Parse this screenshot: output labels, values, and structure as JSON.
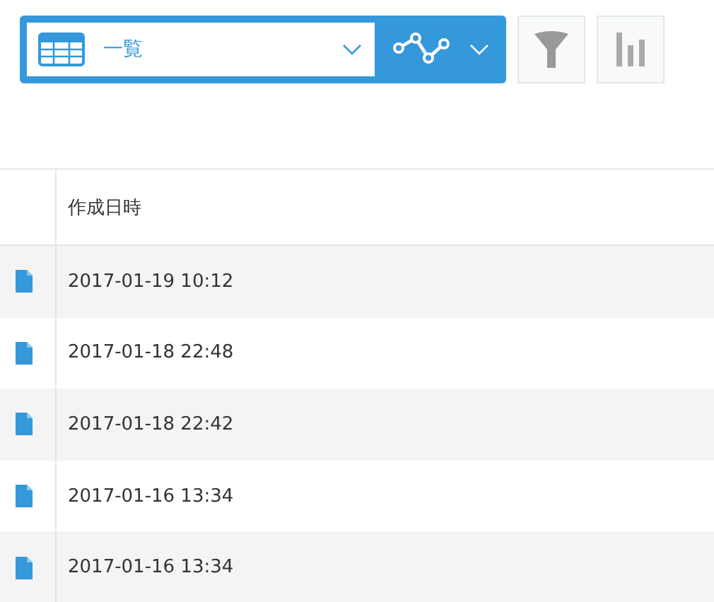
{
  "view_select": {
    "label": "一覧"
  },
  "table": {
    "columns": [
      "作成日時"
    ],
    "rows": [
      {
        "created": "2017-01-19 10:12"
      },
      {
        "created": "2017-01-18 22:48"
      },
      {
        "created": "2017-01-18 22:42"
      },
      {
        "created": "2017-01-16 13:34"
      },
      {
        "created": "2017-01-16 13:34"
      }
    ]
  }
}
